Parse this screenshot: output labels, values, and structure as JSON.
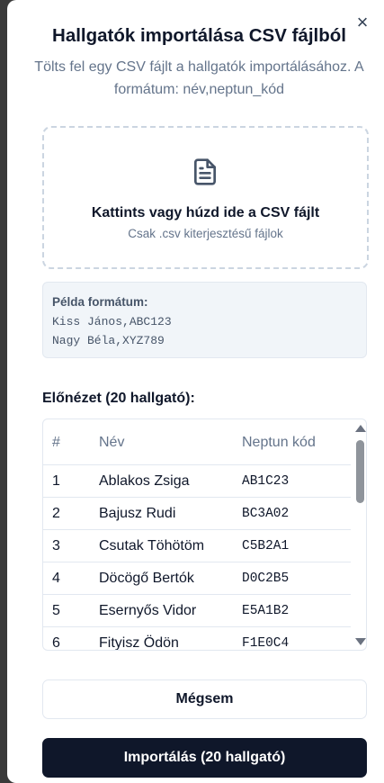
{
  "dialog": {
    "title": "Hallgatók importálása CSV fájlból",
    "subtitle": "Tölts fel egy CSV fájlt a hallgatók importálásához. A formátum: név,neptun_kód",
    "close_icon": "×"
  },
  "dropzone": {
    "icon": "file-text-icon",
    "main_text": "Kattints vagy húzd ide a CSV fájlt",
    "sub_text": "Csak .csv kiterjesztésű fájlok"
  },
  "example": {
    "title": "Példa formátum:",
    "lines": [
      "Kiss János,ABC123",
      "Nagy Béla,XYZ789"
    ]
  },
  "preview": {
    "label": "Előnézet (20 hallgató):",
    "columns": [
      "#",
      "Név",
      "Neptun kód"
    ],
    "rows": [
      [
        "1",
        "Ablakos Zsiga",
        "AB1C23"
      ],
      [
        "2",
        "Bajusz Rudi",
        "BC3A02"
      ],
      [
        "3",
        "Csutak Töhötöm",
        "C5B2A1"
      ],
      [
        "4",
        "Döcögő Bertók",
        "D0C2B5"
      ],
      [
        "5",
        "Esernyős Vidor",
        "E5A1B2"
      ],
      [
        "6",
        "Fityisz Ödön",
        "F1E0C4"
      ]
    ]
  },
  "buttons": {
    "cancel": "Mégsem",
    "import": "Importálás (20 hallgató)"
  },
  "colors": {
    "primary": "#0f172a",
    "muted": "#64748b",
    "border": "#e2e8f0"
  }
}
